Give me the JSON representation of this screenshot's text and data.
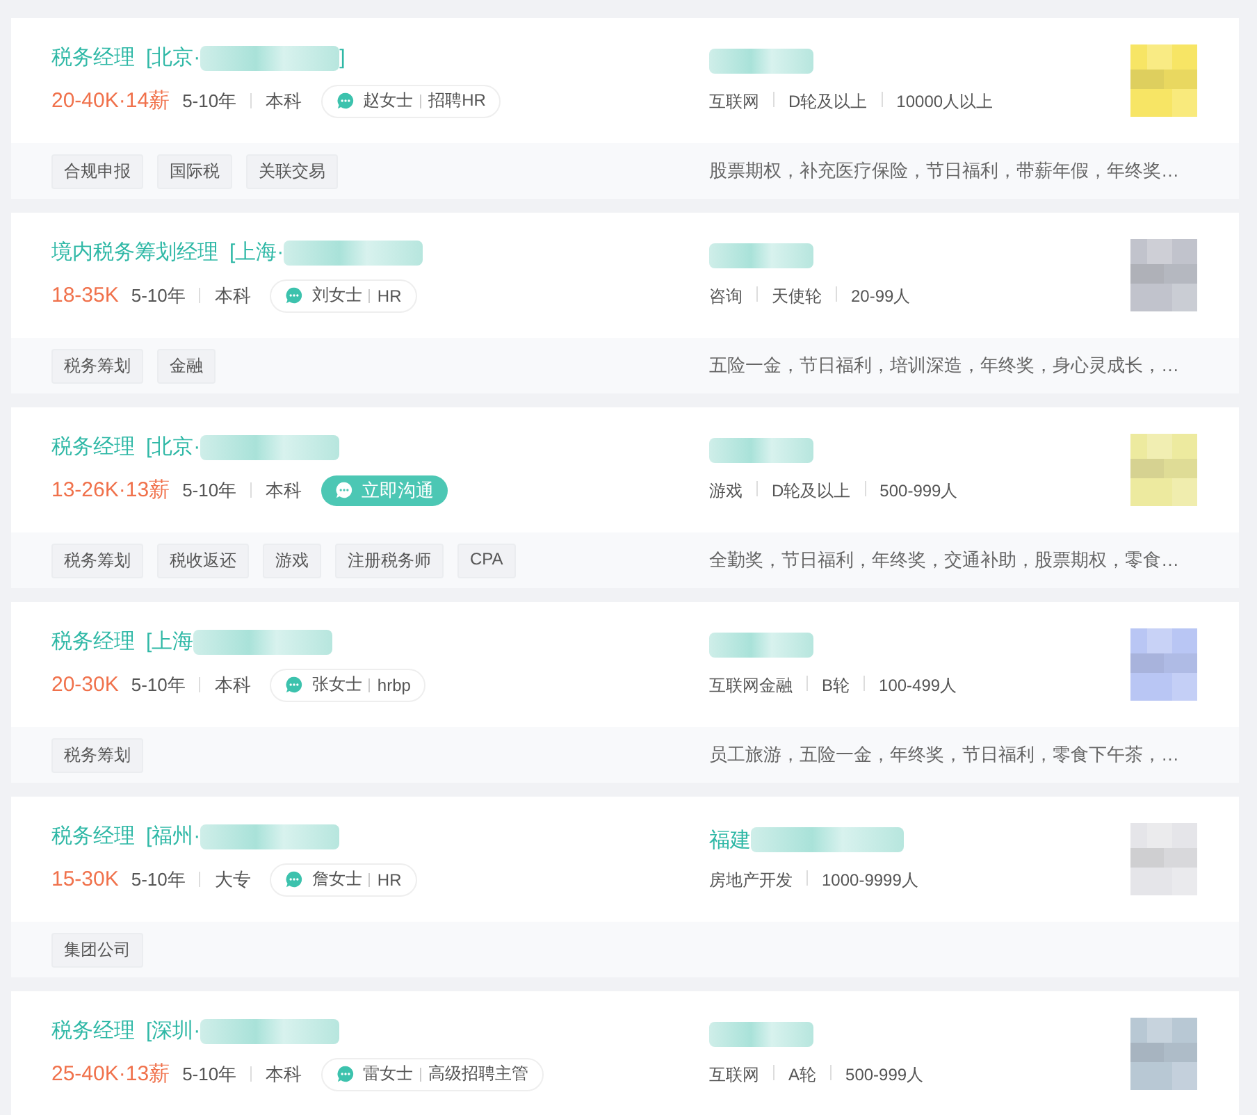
{
  "jobs": [
    {
      "title": "税务经理",
      "location": "[北京·",
      "location_close": "]",
      "salary": "20-40K·14薪",
      "experience": "5-10年",
      "education": "本科",
      "contact": {
        "kind": "recruiter",
        "name": "赵女士",
        "role": "招聘HR"
      },
      "company": {
        "meta": [
          "互联网",
          "D轮及以上",
          "10000人以上"
        ],
        "logo": {
          "kind": "picture"
        }
      },
      "tags": [
        "合规申报",
        "国际税",
        "关联交易"
      ],
      "benefits": "股票期权，补充医疗保险，节日福利，带薪年假，年终奖…"
    },
    {
      "title": "境内税务筹划经理",
      "location": "[上海·",
      "salary": "18-35K",
      "experience": "5-10年",
      "education": "本科",
      "contact": {
        "kind": "recruiter",
        "name": "刘女士",
        "role": "HR"
      },
      "company": {
        "meta": [
          "咨询",
          "天使轮",
          "20-99人"
        ],
        "logo": {
          "kind": "picture"
        }
      },
      "tags": [
        "税务筹划",
        "金融"
      ],
      "benefits": "五险一金，节日福利，培训深造，年终奖，身心灵成长，…"
    },
    {
      "title": "税务经理",
      "location": "[北京·",
      "salary": "13-26K·13薪",
      "experience": "5-10年",
      "education": "本科",
      "contact": {
        "kind": "chat_button",
        "label": "立即沟通"
      },
      "company": {
        "meta": [
          "游戏",
          "D轮及以上",
          "500-999人"
        ],
        "logo": {
          "kind": "picture"
        }
      },
      "tags": [
        "税务筹划",
        "税收返还",
        "游戏",
        "注册税务师",
        "CPA"
      ],
      "benefits": "全勤奖，节日福利，年终奖，交通补助，股票期权，零食…"
    },
    {
      "title": "税务经理",
      "location": "[上海",
      "salary": "20-30K",
      "experience": "5-10年",
      "education": "本科",
      "contact": {
        "kind": "recruiter",
        "name": "张女士",
        "role": "hrbp"
      },
      "company": {
        "meta": [
          "互联网金融",
          "B轮",
          "100-499人"
        ],
        "logo": {
          "kind": "picture"
        }
      },
      "tags": [
        "税务筹划"
      ],
      "benefits": "员工旅游，五险一金，年终奖，节日福利，零食下午茶，…"
    },
    {
      "title": "税务经理",
      "location": "[福州·",
      "salary": "15-30K",
      "experience": "5-10年",
      "education": "大专",
      "contact": {
        "kind": "recruiter",
        "name": "詹女士",
        "role": "HR"
      },
      "company": {
        "name": "福建",
        "meta": [
          "房地产开发",
          "1000-9999人"
        ],
        "logo": {
          "kind": "picture"
        }
      },
      "tags": [
        "集团公司"
      ]
    },
    {
      "title": "税务经理",
      "location": "[深圳·",
      "salary": "25-40K·13薪",
      "experience": "5-10年",
      "education": "本科",
      "contact": {
        "kind": "recruiter",
        "name": "雷女士",
        "role": "高级招聘主管"
      },
      "company": {
        "meta": [
          "互联网",
          "A轮",
          "500-999人"
        ],
        "logo": {
          "kind": "picture"
        }
      }
    }
  ]
}
